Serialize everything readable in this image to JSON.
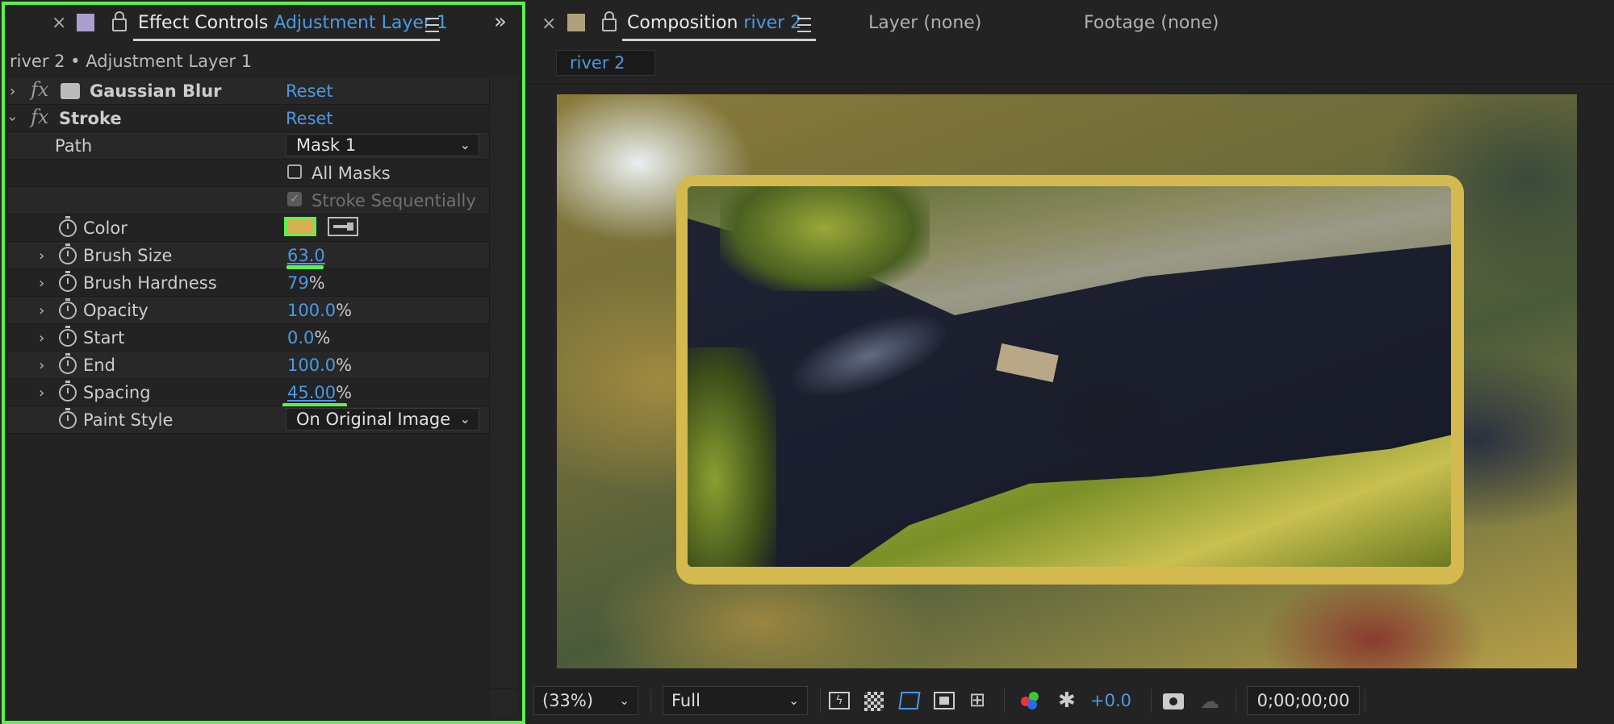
{
  "effect_controls": {
    "tab_title": "Effect Controls",
    "tab_layer": "Adjustment Layer 1",
    "breadcrumb": "river 2 • Adjustment Layer 1",
    "panel_swatch_color": "#a99fd0",
    "effects": [
      {
        "name": "Gaussian Blur",
        "reset": "Reset",
        "expanded": false
      },
      {
        "name": "Stroke",
        "reset": "Reset",
        "expanded": true
      }
    ],
    "stroke": {
      "path_label": "Path",
      "path_value": "Mask 1",
      "all_masks_label": "All Masks",
      "all_masks_checked": false,
      "stroke_seq_label": "Stroke Sequentially",
      "stroke_seq_checked": true,
      "color_label": "Color",
      "color_value": "#d6b14f",
      "brush_size_label": "Brush Size",
      "brush_size_value": "63.0",
      "brush_hardness_label": "Brush Hardness",
      "brush_hardness_value": "79",
      "brush_hardness_unit": "%",
      "opacity_label": "Opacity",
      "opacity_value": "100.0",
      "opacity_unit": "%",
      "start_label": "Start",
      "start_value": "0.0",
      "start_unit": "%",
      "end_label": "End",
      "end_value": "100.0",
      "end_unit": "%",
      "spacing_label": "Spacing",
      "spacing_value": "45.00",
      "spacing_unit": "%",
      "paint_style_label": "Paint Style",
      "paint_style_value": "On Original Image"
    }
  },
  "composition": {
    "tab_title": "Composition",
    "tab_comp": "river 2",
    "panel_swatch_color": "#b0a07a",
    "layer_tab": "Layer (none)",
    "footage_tab": "Footage (none)",
    "viewer_tab": "river 2",
    "toolbar": {
      "zoom": "(33%)",
      "resolution": "Full",
      "exposure": "+0.0",
      "timecode": "0;00;00;00"
    }
  },
  "colors": {
    "accent_blue": "#4a9ae3",
    "highlight_green": "#5ef04c",
    "frame_yellow": "#d4b94f"
  }
}
